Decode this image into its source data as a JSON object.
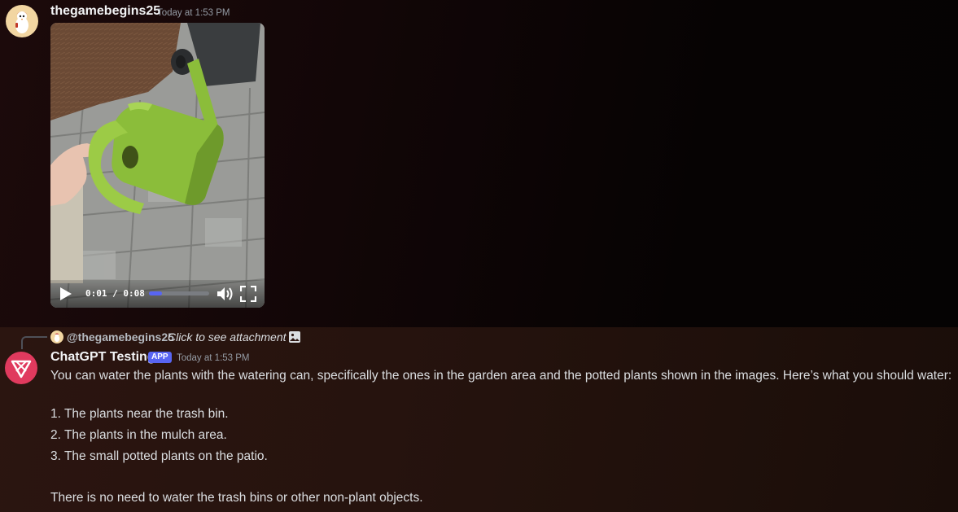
{
  "message1": {
    "username": "thegamebegins25",
    "timestamp": "Today at 1:53 PM",
    "video": {
      "time": "0:01 / 0:08",
      "progress": 0.22
    }
  },
  "message2": {
    "reply": {
      "mention": "@thegamebegins25",
      "text": "Click to see attachment"
    },
    "username": "ChatGPT Testing",
    "badge": "APP",
    "timestamp": "Today at 1:53 PM",
    "intro": "You can water the plants with the watering can, specifically the ones in the garden area and the potted plants shown in the images. Here’s what you should water:",
    "list": [
      "1. The plants near the trash bin.",
      "2. The plants in the mulch area.",
      "3. The small potted plants on the patio."
    ],
    "outro": "There is no need to water the trash bins or other non-plant objects."
  },
  "colors": {
    "blurple": "#5865f2",
    "bot_avatar": "#e03a5e",
    "watering_can": "#8bbd3a"
  }
}
